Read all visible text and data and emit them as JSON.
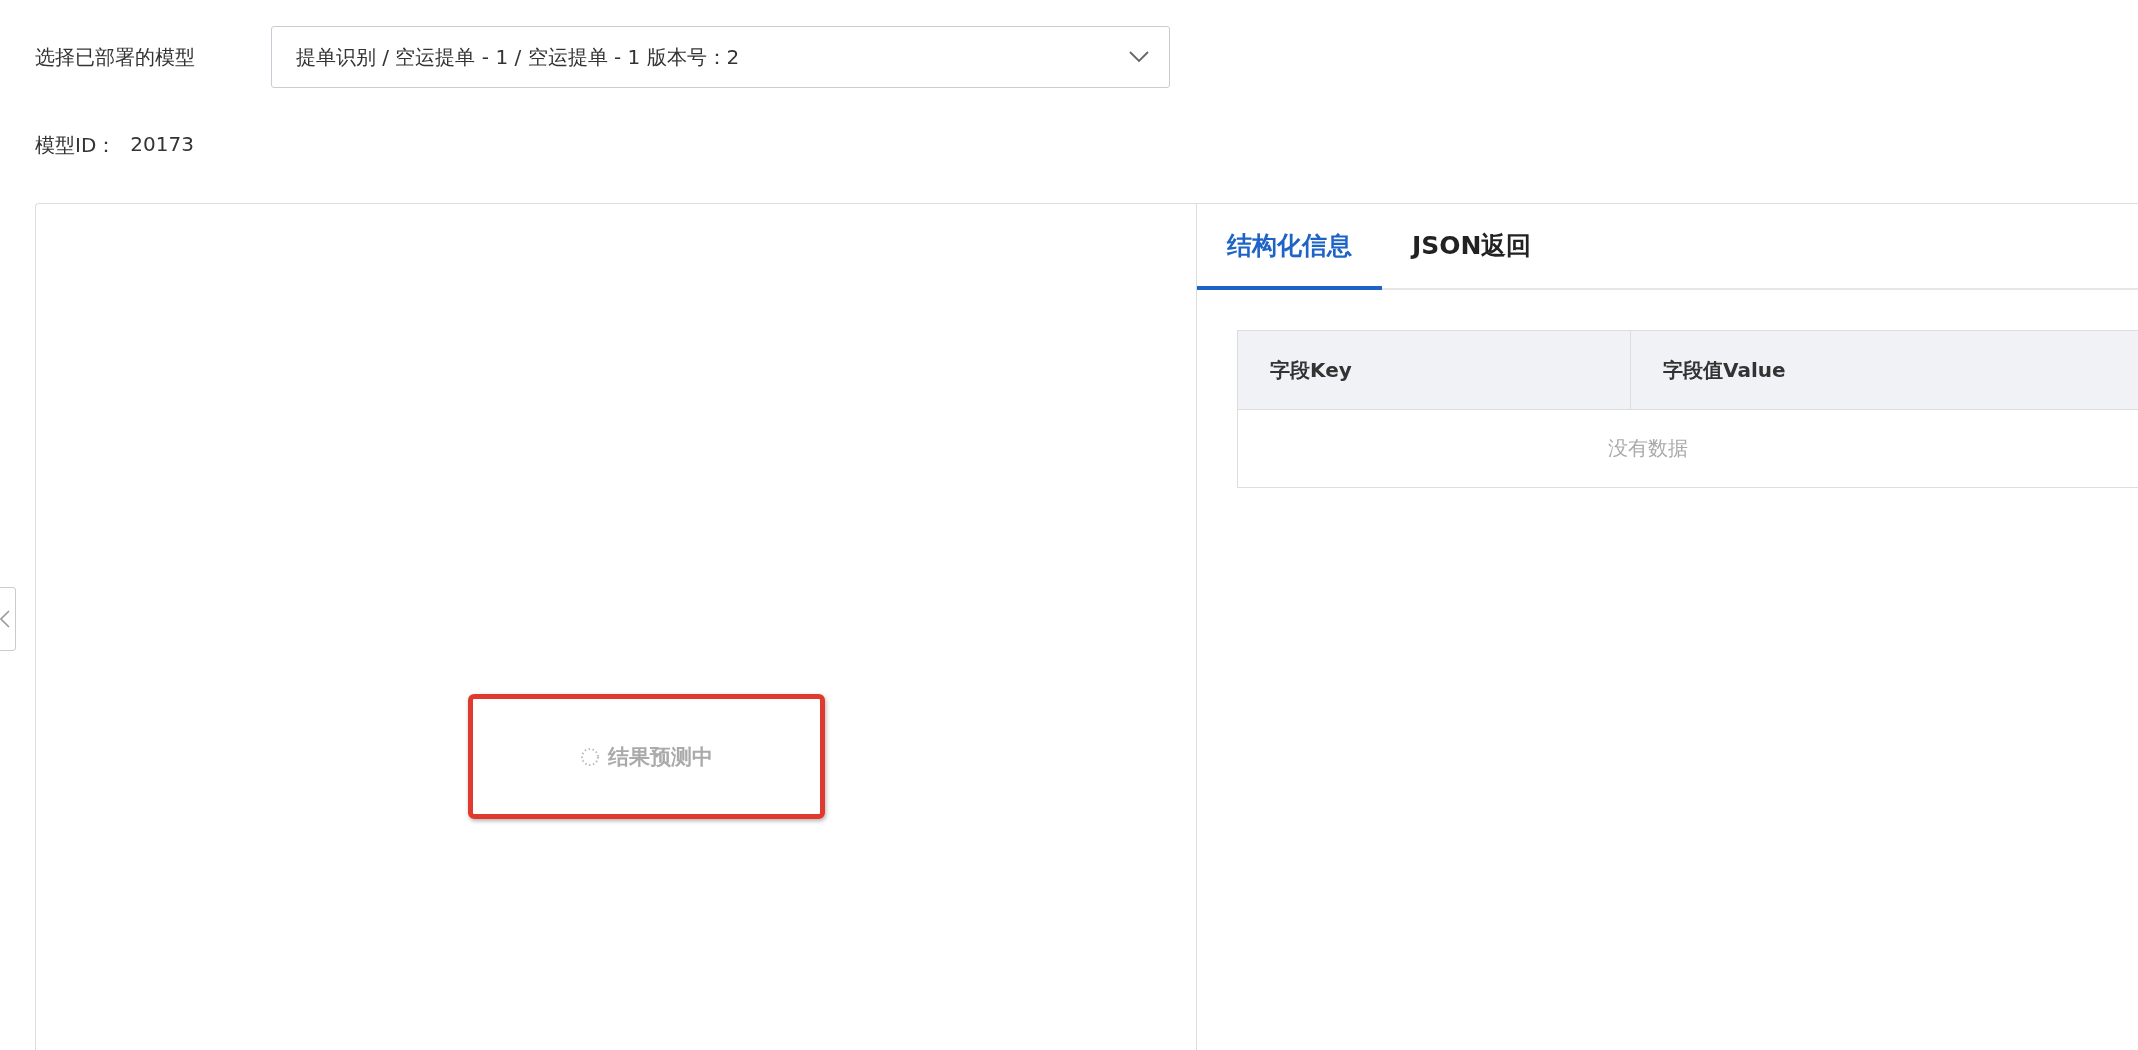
{
  "model_select": {
    "label": "选择已部署的模型",
    "value": "提单识别 / 空运提单 - 1 / 空运提单 - 1 版本号：2"
  },
  "model_id": {
    "label": "模型ID：",
    "value": "20173"
  },
  "preview": {
    "loading_text": "结果预测中",
    "highlighted": true
  },
  "tabs": [
    {
      "label": "结构化信息",
      "selected": true
    },
    {
      "label": "JSON返回",
      "selected": false
    }
  ],
  "table": {
    "columns": [
      "字段Key",
      "字段值Value"
    ],
    "empty_text": "没有数据"
  }
}
